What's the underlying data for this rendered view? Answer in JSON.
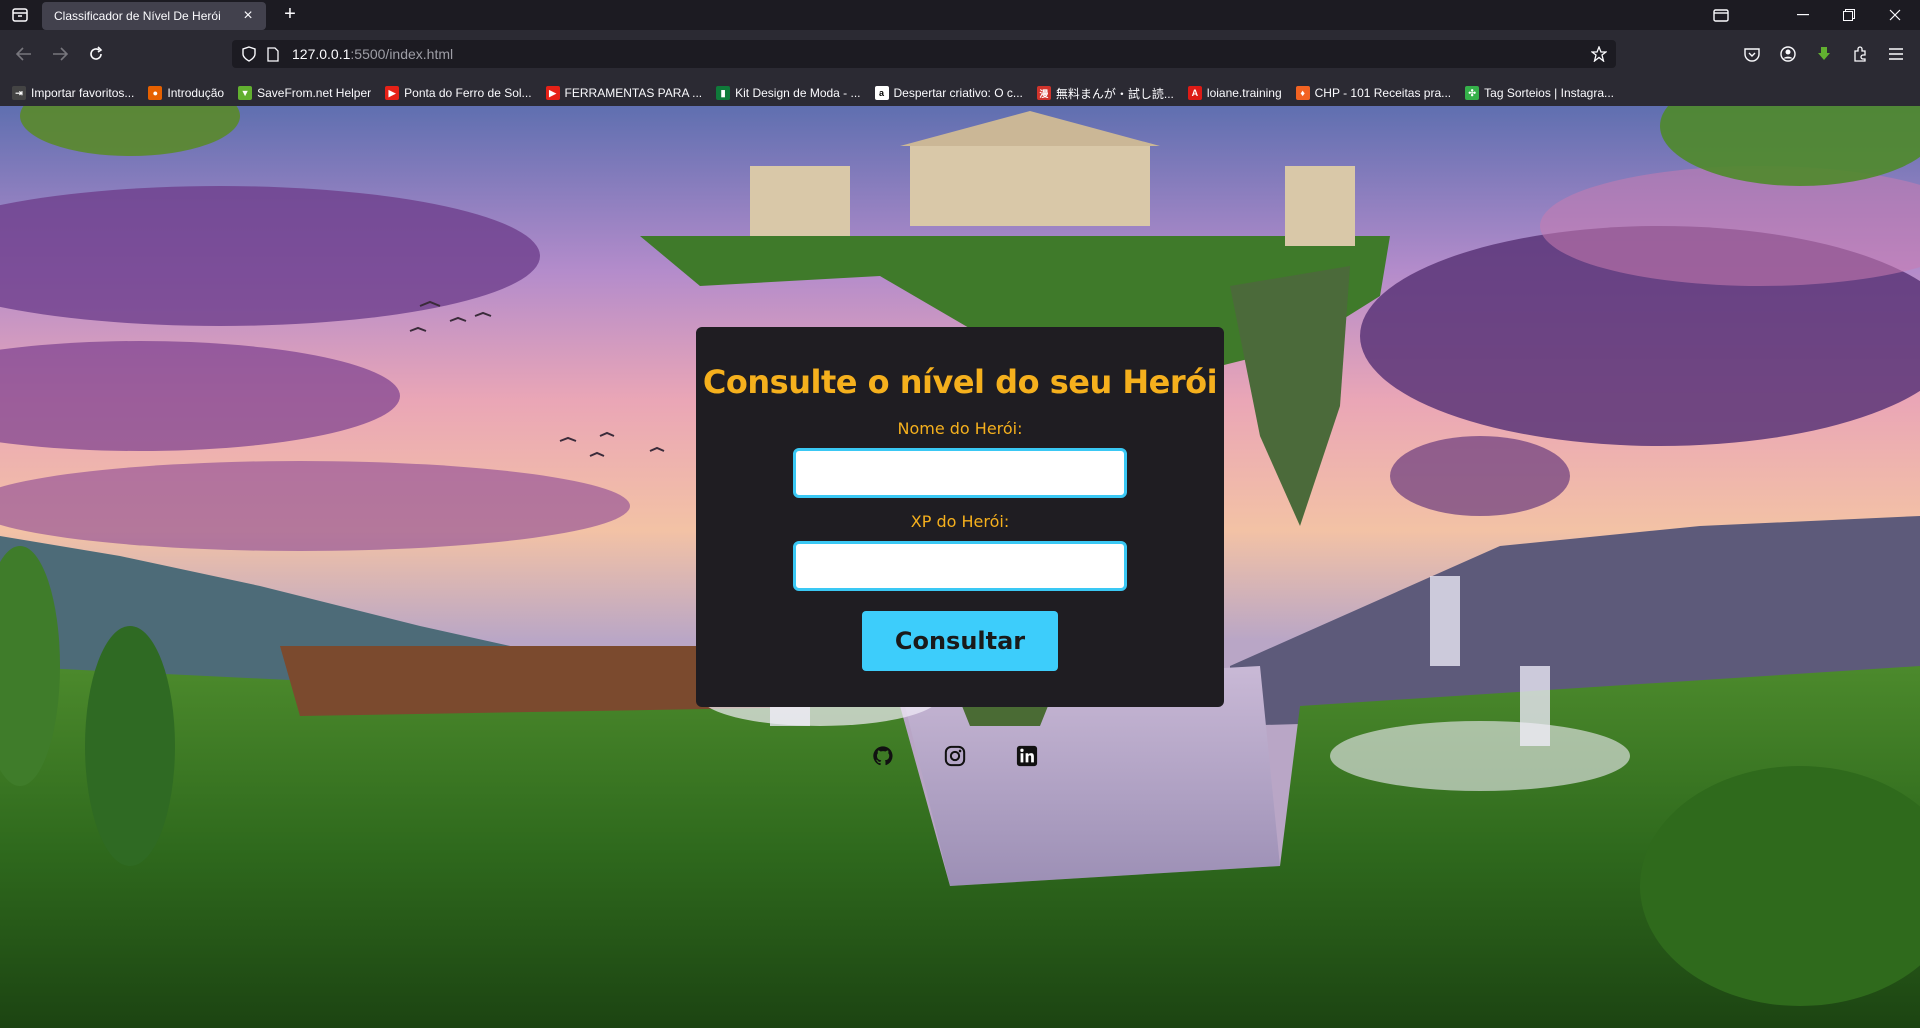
{
  "browser": {
    "tab_title": "Classificador de Nível De Herói",
    "url_host": "127.0.0.1",
    "url_rest": ":5500/index.html"
  },
  "bookmarks": [
    {
      "label": "Importar favoritos...",
      "icon": "import-icon",
      "color": "#444"
    },
    {
      "label": "Introdução",
      "icon": "firefox-icon",
      "color": "#e66000"
    },
    {
      "label": "SaveFrom.net Helper",
      "icon": "download-arrow-icon",
      "color": "#62b030"
    },
    {
      "label": "Ponta do Ferro de Sol...",
      "icon": "youtube-icon",
      "color": "#e62117"
    },
    {
      "label": "FERRAMENTAS PARA ...",
      "icon": "youtube-icon",
      "color": "#e62117"
    },
    {
      "label": "Kit Design de Moda - ...",
      "icon": "book-icon",
      "color": "#0f7a3a"
    },
    {
      "label": "Despertar criativo: O c...",
      "icon": "amazon-icon",
      "color": "#ffffff"
    },
    {
      "label": "無料まんが・試し読...",
      "icon": "manga-icon",
      "color": "#d0342c"
    },
    {
      "label": "loiane.training",
      "icon": "angular-icon",
      "color": "#dd1b16"
    },
    {
      "label": "CHP - 101 Receitas pra...",
      "icon": "flame-icon",
      "color": "#f26322"
    },
    {
      "label": "Tag Sorteios | Instagra...",
      "icon": "clover-icon",
      "color": "#35b04a"
    }
  ],
  "form": {
    "title": "Consulte o nível do seu Herói",
    "name_label": "Nome do Herói:",
    "name_value": "",
    "xp_label": "XP do Herói:",
    "xp_value": "",
    "submit_label": "Consultar"
  },
  "socials": [
    "github-icon",
    "instagram-icon",
    "linkedin-icon"
  ],
  "colors": {
    "accent_gold": "#f5b01d",
    "accent_cyan": "#3dcdfb",
    "card_bg": "#1f1d22"
  }
}
